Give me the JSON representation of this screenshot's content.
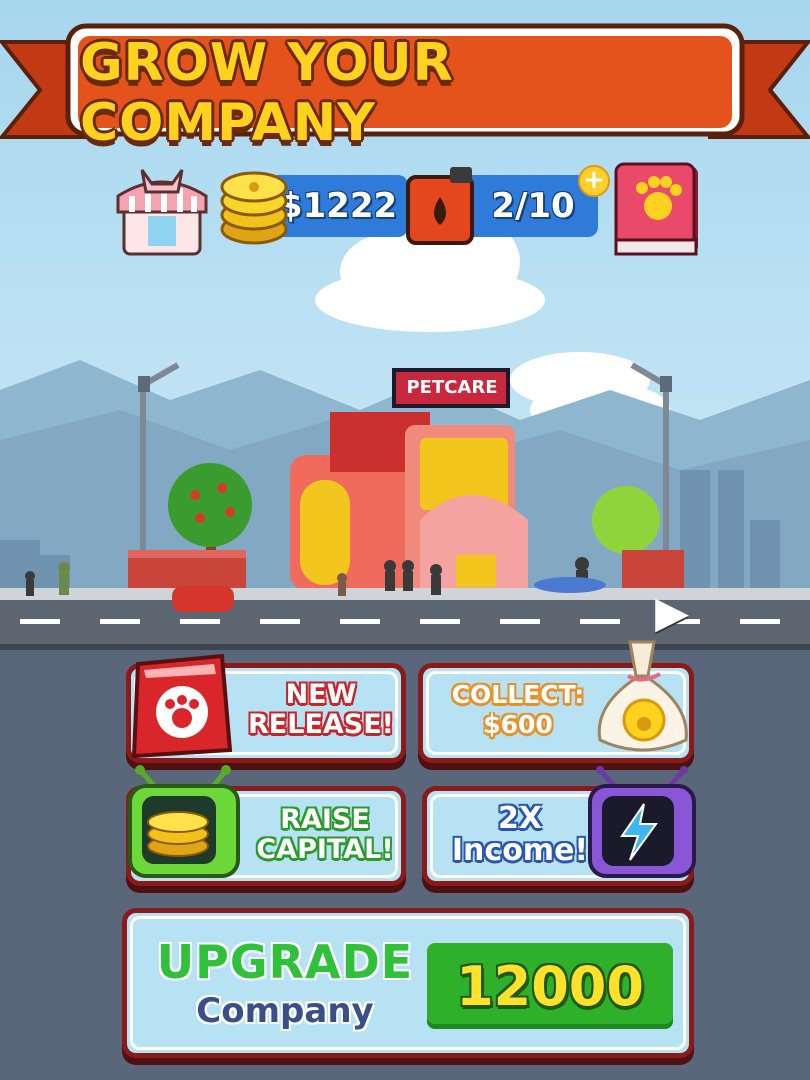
{
  "banner": {
    "title": "GROW YOUR COMPANY"
  },
  "stats": {
    "money": "$1222",
    "fuel": "2/10",
    "plus_glyph": "+",
    "icons": [
      "shop-icon",
      "coins-icon",
      "fuel-can-icon",
      "pet-book-icon"
    ]
  },
  "store": {
    "sign": "PETCARE"
  },
  "scene": {
    "next_arrow_glyph": "▶"
  },
  "actions": {
    "new_release": {
      "line1": "NEW",
      "line2": "RELEASE!"
    },
    "collect": {
      "line1": "COLLECT:",
      "line2": "$600"
    },
    "raise_capital": {
      "line1": "RAISE",
      "line2": "CAPITAL!"
    },
    "double_income": {
      "line1": "2X",
      "line2": "Income!"
    }
  },
  "upgrade": {
    "title": "UPGRADE",
    "subtitle": "Company",
    "price": "12000"
  },
  "colors": {
    "banner_red": "#e4531b",
    "pill_blue": "#2f7bd9",
    "card_bg": "#b7e2f4",
    "card_border": "#8b1a1a",
    "price_green": "#2fb02a",
    "upgrade_green": "#2fc13a"
  }
}
